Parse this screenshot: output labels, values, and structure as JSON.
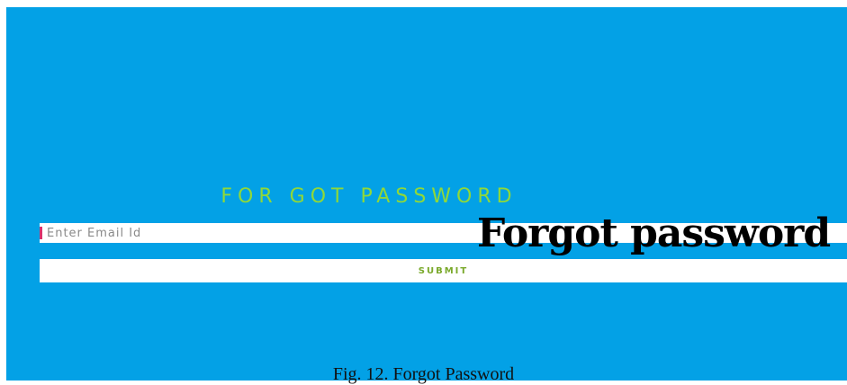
{
  "screen": {
    "heading": "FOR GOT PASSWORD",
    "email_input": {
      "placeholder": "Enter Email Id",
      "value": ""
    },
    "submit_label": "SUBMIT"
  },
  "overlay_label": "Forgot password",
  "caption": "Fig. 12. Forgot Password",
  "colors": {
    "background": "#03a1e6",
    "heading": "#8fd83a",
    "button_text": "#7aa92b",
    "cursor": "#d9336d"
  }
}
